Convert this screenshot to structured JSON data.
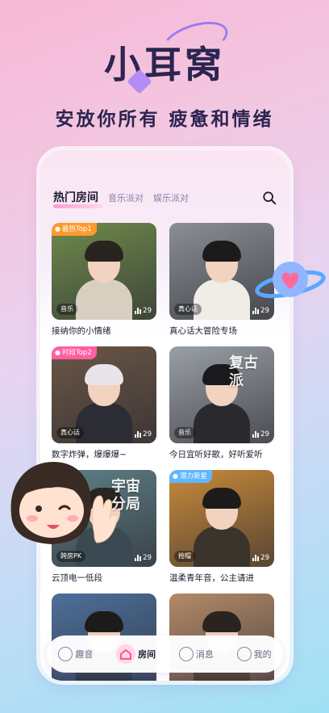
{
  "hero": {
    "title": "小耳窝",
    "subtitle": "安放你所有  疲惫和情绪"
  },
  "header": {
    "tabs": [
      {
        "label": "热门房间",
        "active": true
      },
      {
        "label": "音乐派对",
        "active": false
      },
      {
        "label": "娱乐派对",
        "active": false
      }
    ],
    "search_icon": "search-icon"
  },
  "cards": [
    {
      "title": "接纳你的小情绪",
      "badge": "最热Top1",
      "badge_color": "#ff9a2e",
      "tag": "音乐",
      "count": "29",
      "bg": "#6f8a4c",
      "hair": "#2a2420",
      "shirt": "#d9cfc0"
    },
    {
      "title": "真心话大冒险专场",
      "badge": "",
      "badge_color": "",
      "tag": "真心话",
      "count": "29",
      "bg": "#8a8f95",
      "hair": "#1d1a1a",
      "shirt": "#f0ece6"
    },
    {
      "title": "数字炸弹，爆爆爆~",
      "badge": "时段Top2",
      "badge_color": "#ff5fa0",
      "tag": "真心话",
      "count": "29",
      "bg": "#6b5646",
      "hair": "#e9e4ea",
      "shirt": "#2c2c34"
    },
    {
      "title": "今日宜听好歌，好听爱听",
      "badge": "",
      "badge_color": "",
      "tag": "音乐",
      "count": "29",
      "bg": "#9aa0a6",
      "hair": "#1a1a1c",
      "shirt": "#2a2a2e",
      "overlay": "复古派"
    },
    {
      "title": "云顶电一低段",
      "badge": "",
      "badge_color": "",
      "tag": "跨房PK",
      "count": "29",
      "bg": "#5f7f86",
      "hair": "#2a2420",
      "shirt": "#3b4a52",
      "overlay": "宇宙分局"
    },
    {
      "title": "温柔青年音，公主请进",
      "badge": "潜力新星",
      "badge_color": "#5fb7ff",
      "tag": "抢帽",
      "count": "29",
      "bg": "#c98a3a",
      "hair": "#1d1a1a",
      "shirt": "#3a342c"
    },
    {
      "title": "",
      "badge": "",
      "badge_color": "",
      "tag": "",
      "count": "",
      "bg": "#4d6f9a",
      "hair": "#1d1a1a",
      "shirt": "#2f3a48"
    },
    {
      "title": "",
      "badge": "",
      "badge_color": "",
      "tag": "",
      "count": "",
      "bg": "#b38a68",
      "hair": "#2a2420",
      "shirt": "#4a3a30"
    }
  ],
  "nav": [
    {
      "label": "趣音",
      "icon": "music-note-icon",
      "active": false
    },
    {
      "label": "房间",
      "icon": "house-icon",
      "active": true
    },
    {
      "label": "消息",
      "icon": "chat-bubble-icon",
      "active": false
    },
    {
      "label": "我的",
      "icon": "cat-face-icon",
      "active": false
    }
  ],
  "colors": {
    "accent": "#ff5fa0",
    "title": "#2b2550"
  }
}
